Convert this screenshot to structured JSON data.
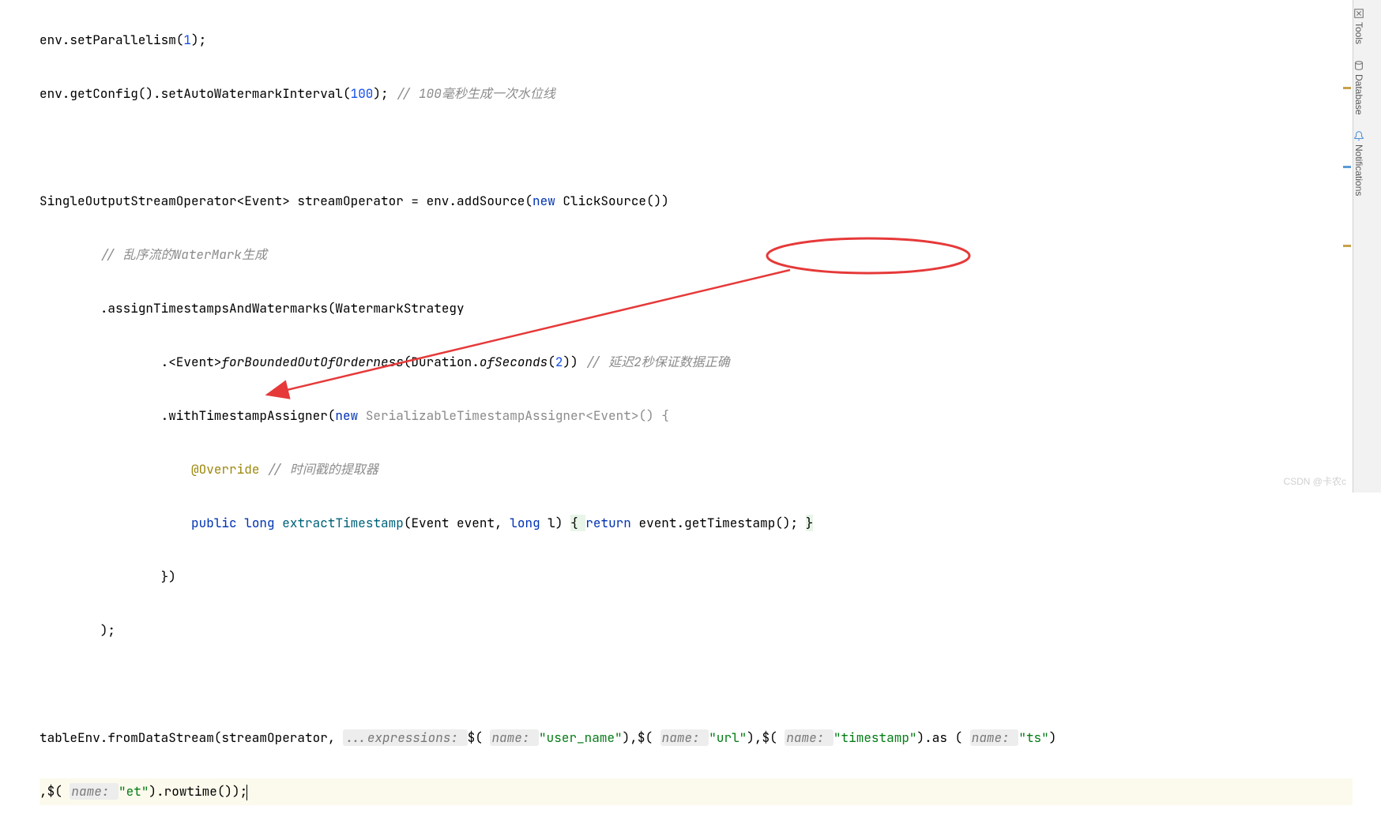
{
  "code": {
    "l1a": "env.setParallelism(",
    "l1n": "1",
    "l1b": ");",
    "l2a": "env.getConfig().setAutoWatermarkInterval(",
    "l2n": "100",
    "l2b": "); ",
    "l2c": "// 100毫秒生成一次水位线",
    "l4a": "SingleOutputStreamOperator<Event> streamOperator = env.addSource(",
    "l4kw": "new",
    "l4b": " ClickSource())",
    "l5c": "// 乱序流的WaterMark生成",
    "l6a": ".assignTimestampsAndWatermarks(WatermarkStrategy",
    "l7a": ".<Event>",
    "l7m": "forBoundedOutOfOrderness",
    "l7b": "(Duration.",
    "l7m2": "ofSeconds",
    "l7c": "(",
    "l7n": "2",
    "l7d": ")) ",
    "l7cm": "// 延迟2秒保证数据正确",
    "l8a": ".withTimestampAssigner(",
    "l8kw": "new",
    "l8b": " SerializableTimestampAssigner<Event>() {",
    "l9ann": "@Override",
    "l9c": " // 时间戳的提取器",
    "l10kw1": "public",
    "l10kw2": "long",
    "l10m": "extractTimestamp",
    "l10a": "(Event event, ",
    "l10kw3": "long",
    "l10b": " l) ",
    "l10br": "{ ",
    "l10kw4": "return",
    "l10c": " event.getTimestamp(); ",
    "l10br2": "}",
    "l11a": "})",
    "l12a": ");",
    "l14a": "tableEnv.fromDataStream(streamOperator, ",
    "l14h1": "...expressions: ",
    "l14b": "$( ",
    "l14h2": "name: ",
    "l14s1": "\"user_name\"",
    "l14c": "),$( ",
    "l14h3": "name: ",
    "l14s2": "\"url\"",
    "l14d": "),$( ",
    "l14h4": "name: ",
    "l14s3": "\"timestamp\"",
    "l14e": ").as ( ",
    "l14h5": "name: ",
    "l14s4": "\"ts\"",
    "l14f": ")",
    "l15a": ",$( ",
    "l15h1": "name: ",
    "l15s1": "\"et\"",
    "l15b": ").rowtime());"
  },
  "sidebar": {
    "tools": "Tools",
    "database": "Database",
    "notifications": "Notifications"
  },
  "watermark": "CSDN @卡农c"
}
